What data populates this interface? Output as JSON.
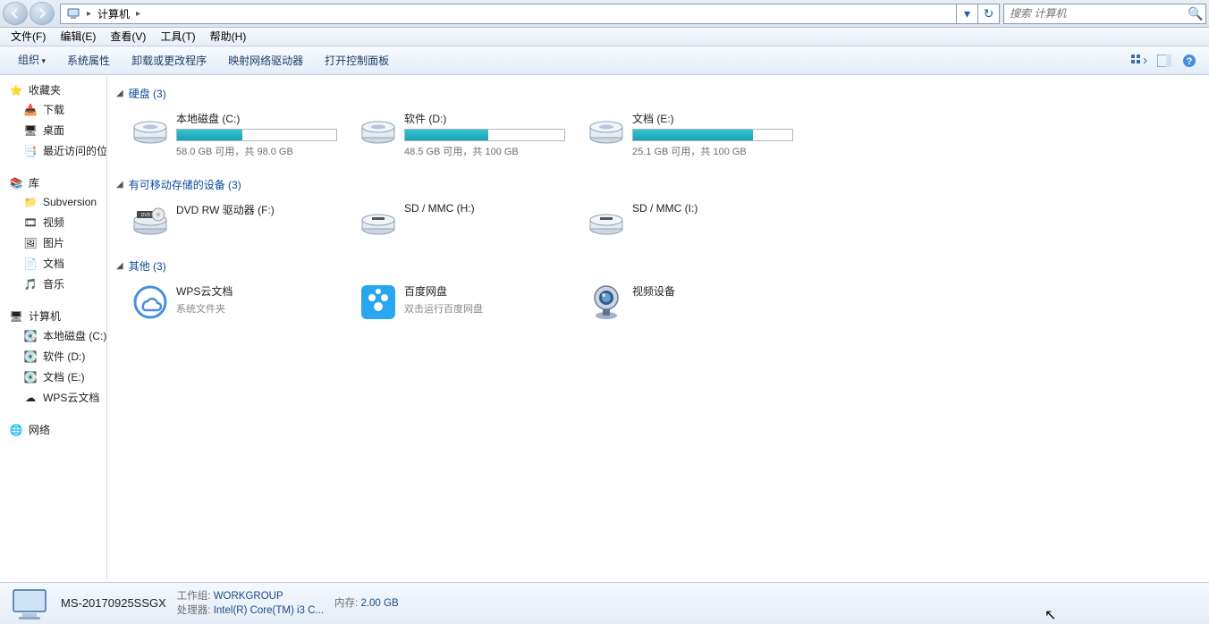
{
  "breadcrumb": {
    "root": "计算机"
  },
  "search": {
    "placeholder": "搜索 计算机"
  },
  "menu": {
    "file": "文件(F)",
    "edit": "编辑(E)",
    "view": "查看(V)",
    "tools": "工具(T)",
    "help": "帮助(H)"
  },
  "toolbar": {
    "organize": "组织",
    "sysprops": "系统属性",
    "uninstall": "卸载或更改程序",
    "mapdrive": "映射网络驱动器",
    "ctrlpanel": "打开控制面板"
  },
  "sidebar": {
    "favorites": {
      "title": "收藏夹",
      "items": [
        "下载",
        "桌面",
        "最近访问的位置"
      ]
    },
    "libraries": {
      "title": "库",
      "items": [
        "Subversion",
        "视频",
        "图片",
        "文档",
        "音乐"
      ]
    },
    "computer": {
      "title": "计算机",
      "items": [
        "本地磁盘 (C:)",
        "软件 (D:)",
        "文档 (E:)",
        "WPS云文档"
      ]
    },
    "network": {
      "title": "网络"
    }
  },
  "sections": {
    "hdd": {
      "title": "硬盘 (3)",
      "drives": [
        {
          "name": "本地磁盘 (C:)",
          "free": "58.0 GB 可用，共 98.0 GB",
          "fill": 41
        },
        {
          "name": "软件 (D:)",
          "free": "48.5 GB 可用，共 100 GB",
          "fill": 52
        },
        {
          "name": "文档 (E:)",
          "free": "25.1 GB 可用，共 100 GB",
          "fill": 75
        }
      ]
    },
    "removable": {
      "title": "有可移动存储的设备 (3)",
      "drives": [
        {
          "name": "DVD RW 驱动器 (F:)"
        },
        {
          "name": "SD / MMC (H:)"
        },
        {
          "name": "SD / MMC (I:)"
        }
      ]
    },
    "other": {
      "title": "其他 (3)",
      "items": [
        {
          "name": "WPS云文档",
          "sub": "系统文件夹"
        },
        {
          "name": "百度网盘",
          "sub": "双击运行百度网盘"
        },
        {
          "name": "视频设备",
          "sub": ""
        }
      ]
    }
  },
  "details": {
    "name": "MS-20170925SSGX",
    "workgroup_k": "工作组:",
    "workgroup_v": "WORKGROUP",
    "cpu_k": "处理器:",
    "cpu_v": "Intel(R) Core(TM) i3 C...",
    "mem_k": "内存:",
    "mem_v": "2.00 GB"
  }
}
